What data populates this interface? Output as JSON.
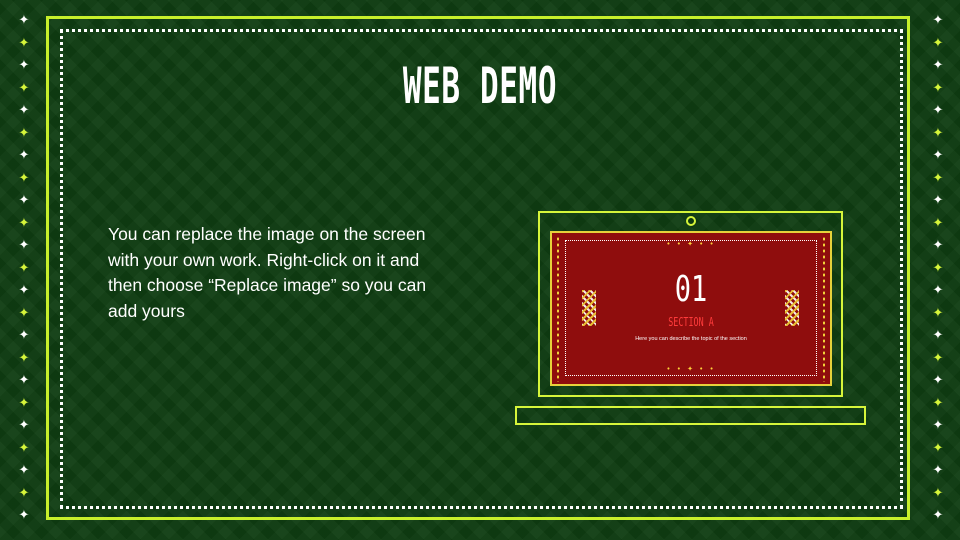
{
  "slide": {
    "title": "WEB DEMO",
    "body": "You can replace the image on the screen with your own work. Right-click on it and then choose “Replace image” so you can add yours"
  },
  "preview": {
    "number": "01",
    "section": "SECTION A",
    "caption": "Here you can describe the topic of the section"
  },
  "colors": {
    "background": "#0f3d12",
    "accent": "#c7ef2b",
    "preview_red": "#8f0d0d",
    "section_red": "#ff3b3b"
  },
  "icons": {
    "border_ornament": "four-point-star-icon",
    "preview_ornament": "zigzag-pattern"
  }
}
